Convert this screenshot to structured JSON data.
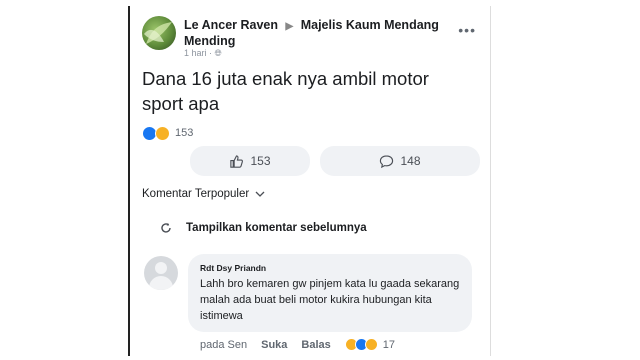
{
  "post": {
    "author": "Le Ancer Raven",
    "group": "Majelis Kaum Mendang Mending",
    "time": "1 hari",
    "separator": "·",
    "privacy_icon": "globe-icon",
    "text": "Dana 16 juta enak nya ambil motor sport apa",
    "reaction_count": "153",
    "like_count": "153",
    "comment_count": "148"
  },
  "comments": {
    "sort_label": "Komentar Terpopuler",
    "show_previous": "Tampilkan komentar sebelumnya",
    "items": [
      {
        "name": "Rdt Dsy Priandn",
        "text": "Lahh bro kemaren gw pinjem kata lu gaada sekarang malah ada buat beli motor kukira hubungan kita istimewa",
        "time": "pada Sen",
        "like_label": "Suka",
        "reply_label": "Balas",
        "reaction_count": "17"
      }
    ]
  },
  "colors": {
    "like_blue": "#1877f2",
    "haha_yellow": "#f7b125",
    "bubble": "#f0f2f5"
  }
}
